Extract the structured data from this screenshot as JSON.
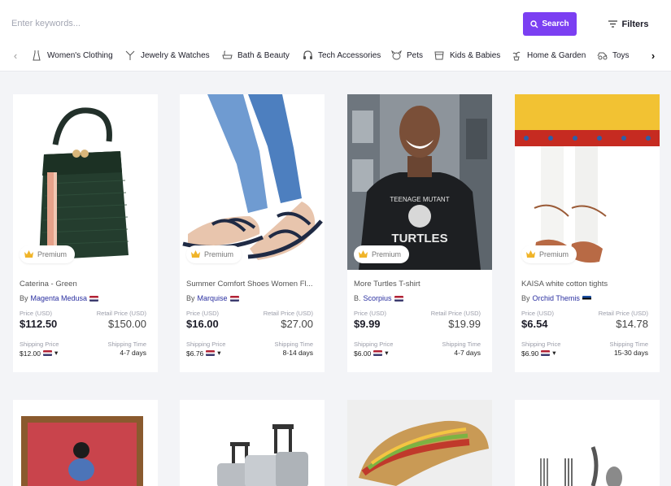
{
  "search": {
    "placeholder": "Enter keywords...",
    "button_label": "Search",
    "filters_label": "Filters"
  },
  "categories": [
    {
      "label": "Women's Clothing",
      "icon": "dress-icon"
    },
    {
      "label": "Jewelry & Watches",
      "icon": "jewelry-icon"
    },
    {
      "label": "Bath & Beauty",
      "icon": "bath-icon"
    },
    {
      "label": "Tech Accessories",
      "icon": "headphones-icon"
    },
    {
      "label": "Pets",
      "icon": "pet-icon"
    },
    {
      "label": "Kids & Babies",
      "icon": "baby-icon"
    },
    {
      "label": "Home & Garden",
      "icon": "plant-icon"
    },
    {
      "label": "Toys",
      "icon": "toy-icon"
    }
  ],
  "labels": {
    "premium": "Premium",
    "by": "By",
    "by_short": "B.",
    "price_label": "Price (USD)",
    "retail_label": "Retail Price (USD)",
    "shipping_label": "Shipping Price",
    "shipping_time_label": "Shipping Time"
  },
  "products": [
    {
      "title": "Caterina - Green",
      "seller": "Magenta Medusa",
      "price": "$112.50",
      "retail": "$150.00",
      "shipping": "$12.00",
      "days": "4-7 days"
    },
    {
      "title": "Summer Comfort Shoes Women Fl...",
      "seller": "Marquise",
      "price": "$16.00",
      "retail": "$27.00",
      "shipping": "$6.76",
      "days": "8-14 days"
    },
    {
      "title": "More Turtles T-shirt",
      "seller": "Scorpius",
      "price": "$9.99",
      "retail": "$19.99",
      "shipping": "$6.00",
      "days": "4-7 days"
    },
    {
      "title": "KAISA white cotton tights",
      "seller": "Orchid Themis",
      "price": "$6.54",
      "retail": "$14.78",
      "shipping": "$6.90",
      "days": "15-30 days"
    }
  ],
  "colors": {
    "accent": "#7b3ff2",
    "seller": "#2a2fa0",
    "premium_crown": "#f0b429"
  }
}
